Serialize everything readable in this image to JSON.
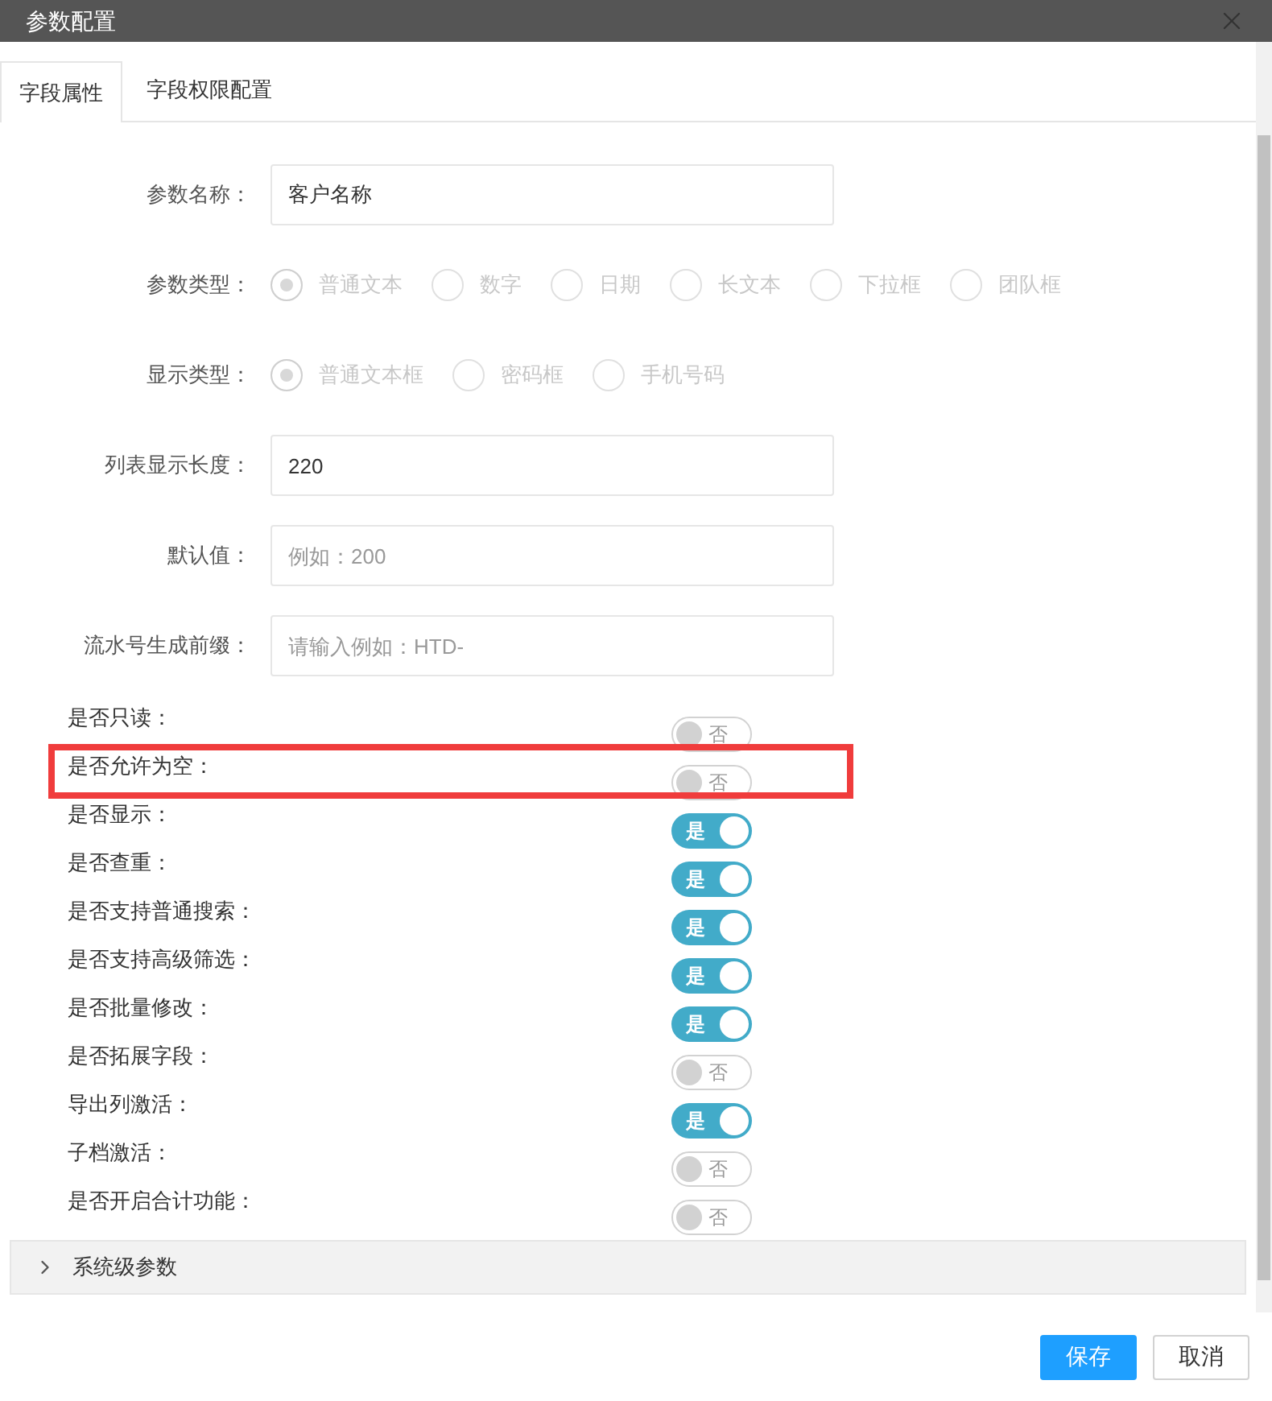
{
  "window": {
    "title": "参数配置"
  },
  "tabs": [
    {
      "label": "字段属性",
      "selected": true
    },
    {
      "label": "字段权限配置",
      "selected": false
    }
  ],
  "fields": [
    {
      "kind": "input",
      "label": "参数名称：",
      "value": "客户名称"
    },
    {
      "kind": "radio",
      "label": "参数类型：",
      "disabled": true,
      "options": [
        {
          "label": "普通文本",
          "selected": true
        },
        {
          "label": "数字",
          "selected": false
        },
        {
          "label": "日期",
          "selected": false
        },
        {
          "label": "长文本",
          "selected": false
        },
        {
          "label": "下拉框",
          "selected": false
        },
        {
          "label": "团队框",
          "selected": false
        }
      ]
    },
    {
      "kind": "radio",
      "label": "显示类型：",
      "disabled": true,
      "options": [
        {
          "label": "普通文本框",
          "selected": true
        },
        {
          "label": "密码框",
          "selected": false
        },
        {
          "label": "手机号码",
          "selected": false
        }
      ]
    },
    {
      "kind": "input",
      "label": "列表显示长度：",
      "value": "220"
    },
    {
      "kind": "input",
      "label": "默认值：",
      "placeholder": "例如：200"
    },
    {
      "kind": "input",
      "label": "流水号生成前缀：",
      "placeholder": "请输入例如：HTD-"
    }
  ],
  "switches": [
    {
      "label": "是否只读：",
      "on": false,
      "text": "否",
      "highlighted": false
    },
    {
      "label": "是否允许为空：",
      "on": false,
      "text": "否",
      "highlighted": true
    },
    {
      "label": "是否显示：",
      "on": true,
      "text": "是",
      "highlighted": false
    },
    {
      "label": "是否查重：",
      "on": true,
      "text": "是",
      "highlighted": false
    },
    {
      "label": "是否支持普通搜索：",
      "on": true,
      "text": "是",
      "highlighted": false
    },
    {
      "label": "是否支持高级筛选：",
      "on": true,
      "text": "是",
      "highlighted": false
    },
    {
      "label": "是否批量修改：",
      "on": true,
      "text": "是",
      "highlighted": false
    },
    {
      "label": "是否拓展字段：",
      "on": false,
      "text": "否",
      "highlighted": false
    },
    {
      "label": "导出列激活：",
      "on": true,
      "text": "是",
      "highlighted": false
    },
    {
      "label": "子档激活：",
      "on": false,
      "text": "否",
      "highlighted": false
    },
    {
      "label": "是否开启合计功能：",
      "on": false,
      "text": "否",
      "highlighted": false
    }
  ],
  "section": {
    "title": "系统级参数",
    "expanded": false
  },
  "buttons": [
    {
      "label": "保存",
      "kind": "primary"
    },
    {
      "label": "取消",
      "kind": "default"
    }
  ]
}
